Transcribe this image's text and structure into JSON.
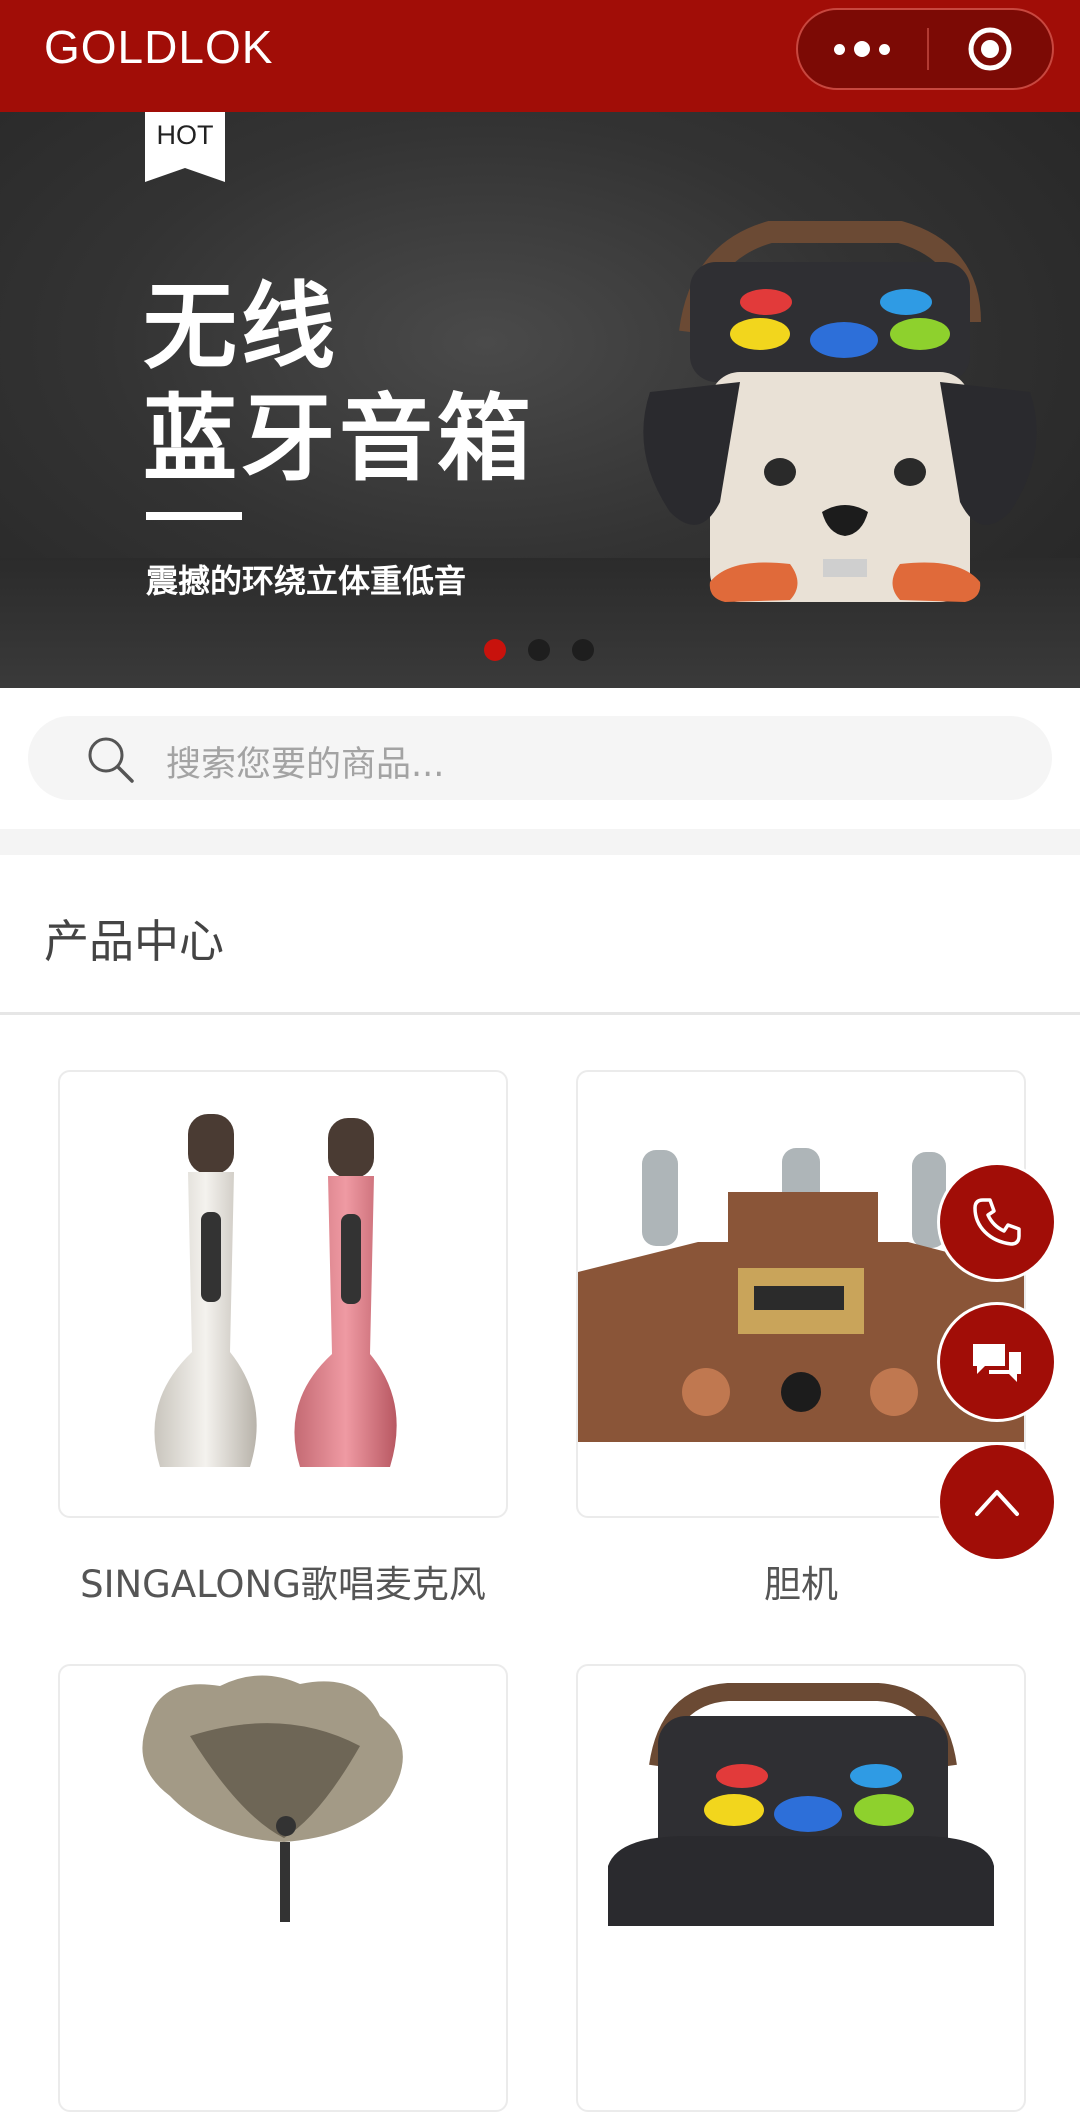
{
  "header": {
    "brand": "GOLDLOK",
    "more_icon": "more-dots-icon",
    "close_icon": "target-circle-icon"
  },
  "banner": {
    "tag": "HOT",
    "title_line1": "无线",
    "title_line2": "蓝牙音箱",
    "subtitle": "震撼的环绕立体重低音",
    "slides": 3,
    "active_slide": 1
  },
  "search": {
    "placeholder": "搜索您要的商品..."
  },
  "section": {
    "title": "产品中心"
  },
  "products": [
    {
      "name": "SINGALONG歌唱麦克风"
    },
    {
      "name": "胆机"
    },
    {
      "name": ""
    },
    {
      "name": ""
    }
  ],
  "floating": {
    "phone_icon": "phone-icon",
    "chat_icon": "chat-bubbles-icon",
    "top_icon": "chevron-up-icon"
  },
  "colors": {
    "brand_red": "#a10d07",
    "dot_active": "#c8120c"
  }
}
